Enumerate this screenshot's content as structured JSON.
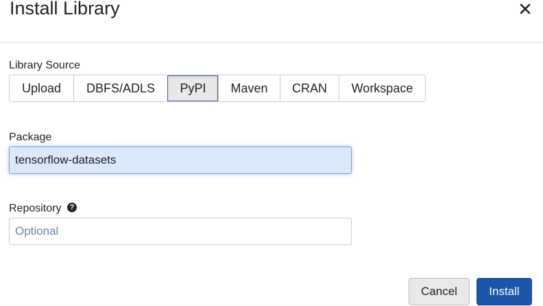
{
  "dialog": {
    "title": "Install Library",
    "close_icon": "close-icon"
  },
  "library_source": {
    "label": "Library Source",
    "options": [
      "Upload",
      "DBFS/ADLS",
      "PyPI",
      "Maven",
      "CRAN",
      "Workspace"
    ],
    "selected": "PyPI"
  },
  "package": {
    "label": "Package",
    "value": "tensorflow-datasets"
  },
  "repository": {
    "label": "Repository",
    "help_icon": "question-circle-icon",
    "placeholder": "Optional",
    "value": ""
  },
  "actions": {
    "cancel_label": "Cancel",
    "install_label": "Install",
    "install_color": "#1b56a8"
  }
}
